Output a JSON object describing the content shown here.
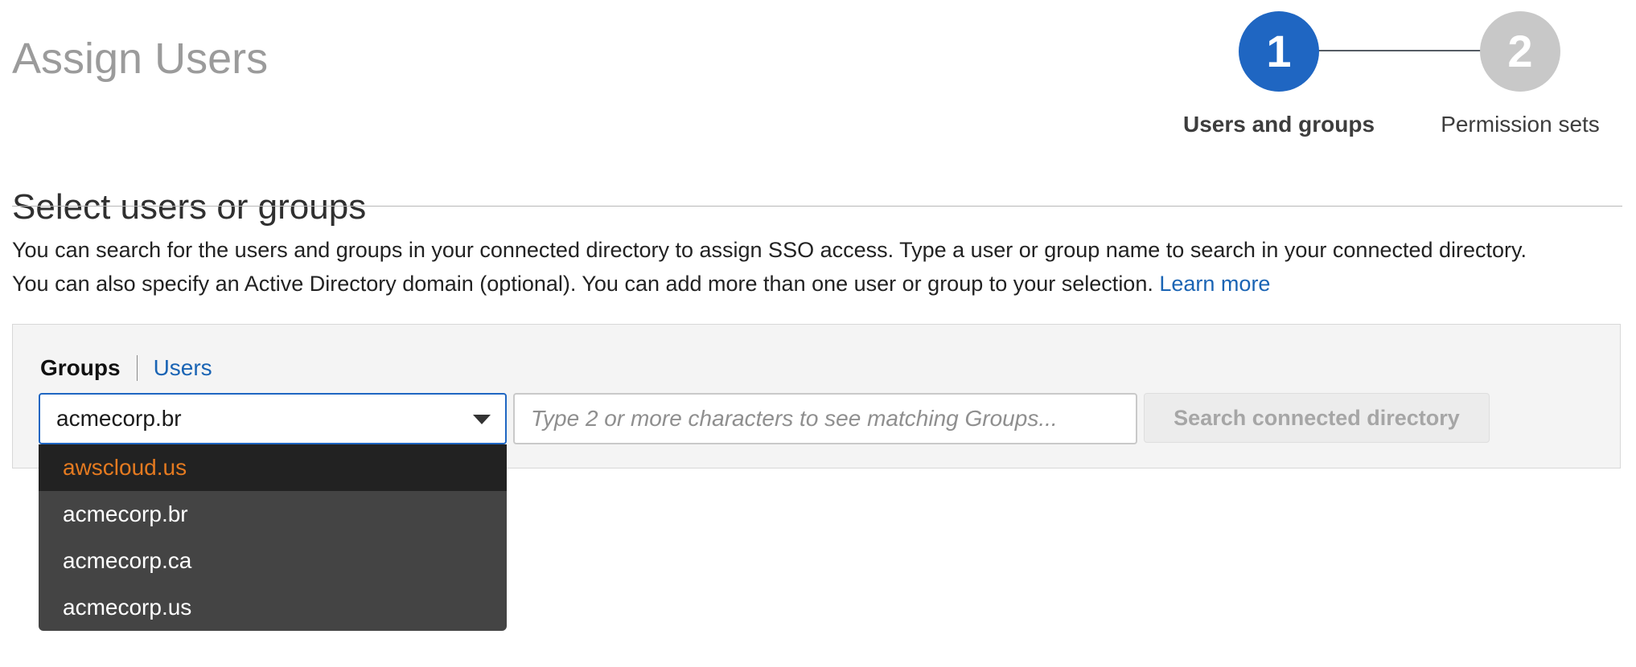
{
  "page": {
    "title": "Assign Users"
  },
  "stepper": {
    "steps": [
      {
        "number": "1",
        "label": "Users and groups",
        "state": "active",
        "color": "#1f66c2"
      },
      {
        "number": "2",
        "label": "Permission sets",
        "state": "inactive",
        "color": "#c8c8c8"
      }
    ]
  },
  "section": {
    "title": "Select users or groups",
    "description_line1": "You can search for the users and groups in your connected directory to assign SSO access. Type a user or group name to search in your connected directory.",
    "description_line2": "You can also specify an Active Directory domain (optional). You can add more than one user or group to your selection.",
    "learn_more": "Learn more"
  },
  "toggle": {
    "groups_label": "Groups",
    "users_label": "Users",
    "selected": "Groups"
  },
  "domain_select": {
    "value": "acmecorp.br",
    "options": [
      {
        "label": "awscloud.us",
        "highlighted": true
      },
      {
        "label": "acmecorp.br",
        "highlighted": false
      },
      {
        "label": "acmecorp.ca",
        "highlighted": false
      },
      {
        "label": "acmecorp.us",
        "highlighted": false
      }
    ]
  },
  "search": {
    "value": "",
    "placeholder": "Type 2 or more characters to see matching Groups...",
    "button_label": "Search connected directory",
    "button_disabled": true
  },
  "colors": {
    "accent": "#1f66c2",
    "link": "#1a64b4",
    "highlight_text": "#e47a20",
    "dropdown_bg": "#444444"
  }
}
